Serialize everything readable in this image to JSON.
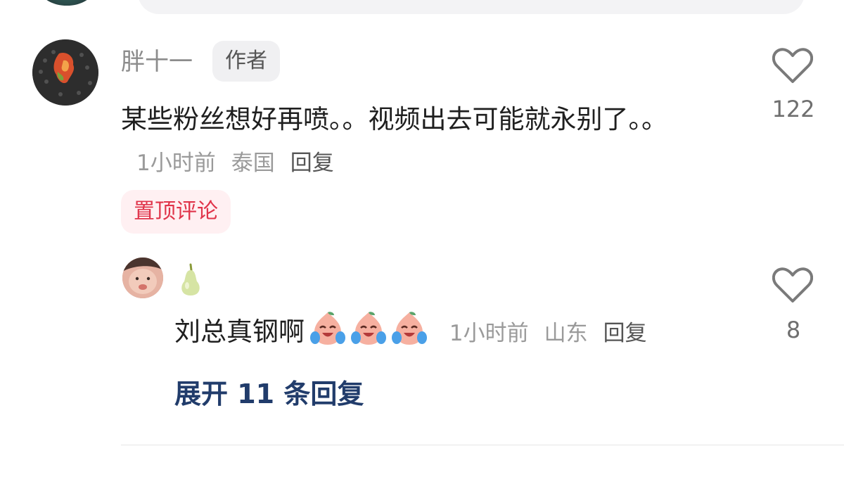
{
  "main_comment": {
    "username": "胖十一",
    "badge": "作者",
    "text": "某些粉丝想好再喷。。视频出去可能就永别了。。",
    "time": "1小时前",
    "location": "泰国",
    "reply_label": "回复",
    "pinned_label": "置顶评论",
    "like_count": "122",
    "avatar_icon": "dish-photo-avatar"
  },
  "reply_comment": {
    "username_icon": "pear-icon",
    "text": "刘总真钢啊",
    "emojis": [
      "crying-laughing-peach-emoji",
      "crying-laughing-peach-emoji",
      "crying-laughing-peach-emoji"
    ],
    "time": "1小时前",
    "location": "山东",
    "reply_label": "回复",
    "like_count": "8",
    "avatar_icon": "child-face-avatar"
  },
  "expand_replies_label": "展开 11 条回复",
  "colors": {
    "pinned_text": "#e0344a",
    "pinned_bg": "#fff0f2",
    "expand_link": "#213c6b",
    "meta_gray": "#9a9a9a",
    "badge_bg": "#f0f0f2"
  }
}
